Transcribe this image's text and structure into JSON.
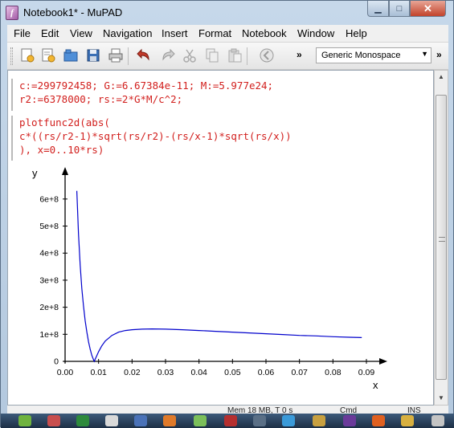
{
  "window": {
    "title": "Notebook1* - MuPAD"
  },
  "menu": [
    "File",
    "Edit",
    "View",
    "Navigation",
    "Insert",
    "Format",
    "Notebook",
    "Window",
    "Help"
  ],
  "toolbar": {
    "font_select": "Generic Monospace",
    "buttons": [
      "new-notebook-icon",
      "new-editor-icon",
      "open-icon",
      "save-icon",
      "print-icon",
      "undo-icon",
      "redo-icon",
      "cut-icon",
      "copy-icon",
      "paste-icon",
      "stop-icon"
    ]
  },
  "notebook": {
    "input1_line1": "c:=299792458; G:=6.67384e-11; M:=5.977e24;",
    "input1_line2": "r2:=6378000; rs:=2*G*M/c^2;",
    "input2_line1": "plotfunc2d(abs(",
    "input2_line2": "c*((rs/r2-1)*sqrt(rs/r2)-(rs/x-1)*sqrt(rs/x))",
    "input2_line3": "), x=0..10*rs)"
  },
  "chart_data": {
    "type": "line",
    "xlabel": "x",
    "ylabel": "y",
    "xlim": [
      0,
      0.09
    ],
    "ylim": [
      0,
      650000000
    ],
    "x_ticks": [
      "0.00",
      "0.01",
      "0.02",
      "0.03",
      "0.04",
      "0.05",
      "0.06",
      "0.07",
      "0.08",
      "0.09"
    ],
    "y_ticks": [
      "0",
      "1e+8",
      "2e+8",
      "3e+8",
      "4e+8",
      "5e+8",
      "6e+8"
    ],
    "grid": false,
    "series": [
      {
        "color": "#0000cc",
        "x": [
          0.0035,
          0.004,
          0.0045,
          0.005,
          0.0055,
          0.006,
          0.0065,
          0.007,
          0.0075,
          0.008,
          0.0085,
          0.0087,
          0.009,
          0.0095,
          0.01,
          0.011,
          0.012,
          0.014,
          0.016,
          0.018,
          0.02,
          0.023,
          0.026,
          0.03,
          0.035,
          0.04,
          0.045,
          0.05,
          0.055,
          0.06,
          0.065,
          0.07,
          0.075,
          0.08,
          0.085,
          0.0886
        ],
        "y": [
          630000000,
          470000000,
          355000000,
          270000000,
          205000000,
          150000000,
          108000000,
          72000000,
          44000000,
          22000000,
          6000000,
          0,
          8000000,
          22000000,
          36000000,
          58000000,
          75000000,
          96000000,
          108000000,
          114000000,
          117000000,
          119000000,
          120000000,
          119000000,
          117000000,
          114000000,
          111000000,
          108000000,
          105000000,
          102000000,
          99000000,
          96000000,
          94000000,
          91000000,
          89000000,
          88000000
        ]
      }
    ]
  },
  "status": {
    "memory": "Mem 18 MB, T 0 s",
    "mode": "Cmd",
    "insert": "INS"
  }
}
